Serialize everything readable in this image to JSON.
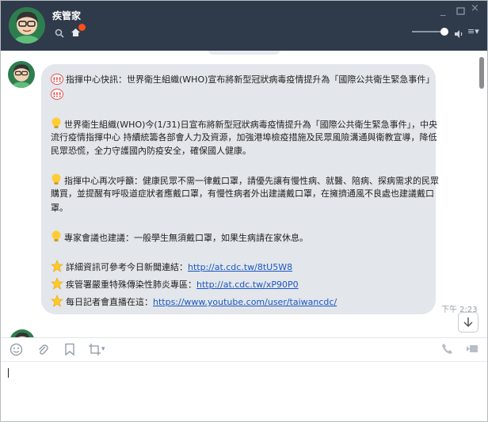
{
  "window": {
    "title": "疾管家",
    "min_symbol": "_",
    "close_symbol": "×",
    "menu_symbol": "≡▾",
    "volume_level": 0.85
  },
  "chat": {
    "notification_count": 1,
    "message": {
      "headline": "指揮中心快訊：世界衛生組織(WHO)宣布將新型冠狀病毒疫情提升為「國際公共衛生緊急事件」",
      "para1_line1": "世界衛生組織(WHO)今(1/31)日宣布將新型冠狀病毒疫情提升為「國際公共衛生緊急事件」，中央",
      "para1_line2": "流行疫情指揮中心 持續統籌各部會人力及資源，加強港埠檢疫措施及民眾風險溝通與衛教宣導，降低",
      "para1_line3": "民眾恐慌，全力守護國內防疫安全，確保國人健康。",
      "para2_line1": "指揮中心再次呼籲：健康民眾不需一律戴口罩，請優先讓有慢性病、就醫、陪病、探病需求的民眾",
      "para2_line2": "購買，並提醒有呼吸道症狀者應戴口罩，有慢性病者外出建議戴口罩，在擁擠通風不良處也建議戴口",
      "para2_line3": "罩。",
      "para3": "專家會議也建議：一般學生無須戴口罩，如果生病請在家休息。",
      "link1_text": "詳細資訊可參考今日新聞連結：",
      "link1_url": "http://at.cdc.tw/8tU5W8",
      "link2_text": "疾管署嚴重特殊傳染性肺炎專區：",
      "link2_url": "http://at.cdc.tw/xP90P0",
      "link3_text": "每日記者會直播在這：",
      "link3_url": "https://www.youtube.com/user/taiwancdc/",
      "time": "下午 2:23"
    }
  },
  "composer": {
    "crop_arrow": "▾",
    "value": ""
  },
  "colors": {
    "titlebar": "#2f3a4b",
    "bubble": "#e3e6ea",
    "link": "#1a57c4",
    "badge": "#ff4e1a"
  },
  "icons": [
    "search-icon",
    "home-icon",
    "speaker-icon",
    "menu-icon",
    "bulb-icon",
    "star-icon",
    "alert-icon",
    "emoji-icon",
    "attachment-icon",
    "bookmark-icon",
    "crop-icon",
    "phone-icon",
    "video-icon",
    "scroll-down-icon"
  ]
}
